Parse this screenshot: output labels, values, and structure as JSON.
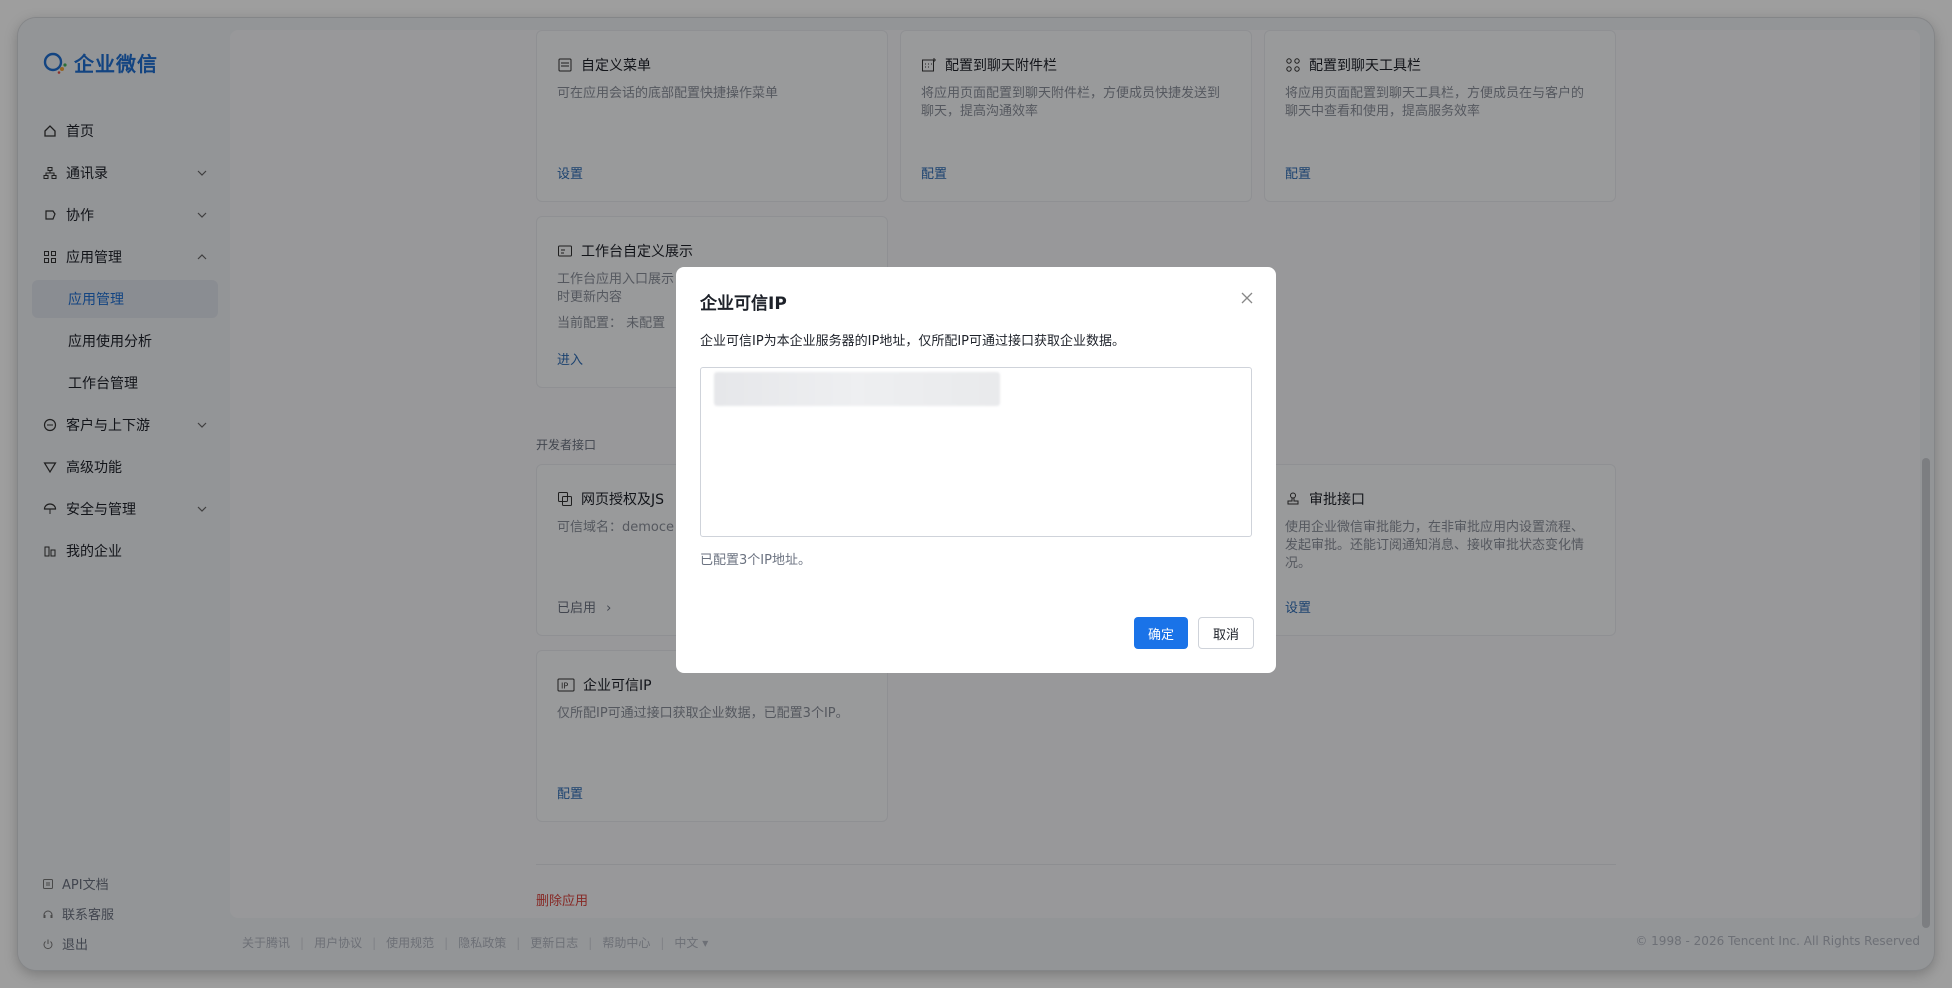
{
  "app": {
    "name": "企业微信",
    "brand_color": "#1f6fd1",
    "accent_color": "#1a73e8"
  },
  "sidebar": {
    "items": [
      {
        "label": "首页",
        "icon": "home-icon",
        "expandable": false
      },
      {
        "label": "通讯录",
        "icon": "org-chart-icon",
        "expandable": true
      },
      {
        "label": "协作",
        "icon": "collab-icon",
        "expandable": true
      },
      {
        "label": "应用管理",
        "icon": "apps-grid-icon",
        "expandable": true,
        "expanded": true
      },
      {
        "label": "客户与上下游",
        "icon": "chat-bubble-icon",
        "expandable": true
      },
      {
        "label": "高级功能",
        "icon": "diamond-icon",
        "expandable": false
      },
      {
        "label": "安全与管理",
        "icon": "umbrella-icon",
        "expandable": true
      },
      {
        "label": "我的企业",
        "icon": "building-icon",
        "expandable": false
      }
    ],
    "subitems": [
      {
        "label": "应用管理",
        "active": true
      },
      {
        "label": "应用使用分析",
        "active": false
      },
      {
        "label": "工作台管理",
        "active": false
      }
    ],
    "footer": [
      {
        "label": "API文档",
        "icon": "doc-icon"
      },
      {
        "label": "联系客服",
        "icon": "headset-icon"
      },
      {
        "label": "退出",
        "icon": "power-icon"
      }
    ]
  },
  "cards": {
    "custom_menu": {
      "title": "自定义菜单",
      "desc": "可在应用会话的底部配置快捷操作菜单",
      "link": "设置"
    },
    "chat_attachment": {
      "title": "配置到聊天附件栏",
      "desc": "将应用页面配置到聊天附件栏，方便成员快捷发送到聊天，提高沟通效率",
      "link": "配置"
    },
    "chat_toolbar": {
      "title": "配置到聊天工具栏",
      "desc": "将应用页面配置到聊天工具栏，方便成员在与客户的聊天中查看和使用，提高服务效率",
      "link": "配置"
    },
    "workbench": {
      "title": "工作台自定义展示",
      "desc": "工作台应用入口展示",
      "desc2": "时更新内容",
      "current": "当前配置：  未配置",
      "link": "进入"
    },
    "web_auth": {
      "title": "网页授权及JS",
      "desc": "可信域名：democe",
      "link": "已启用"
    },
    "approval": {
      "title": "审批接口",
      "desc": "使用企业微信审批能力，在非审批应用内设置流程、发起审批。还能订阅通知消息、接收审批状态变化情况。",
      "link": "设置"
    },
    "trusted_ip": {
      "title": "企业可信IP",
      "desc": "仅所配IP可通过接口获取企业数据，已配置3个IP。",
      "link": "配置"
    }
  },
  "section": {
    "dev_interface": "开发者接口"
  },
  "delete_app": "删除应用",
  "footer": {
    "links": [
      "关于腾讯",
      "用户协议",
      "使用规范",
      "隐私政策",
      "更新日志",
      "帮助中心",
      "中文"
    ],
    "copyright": "© 1998 - 2026 Tencent Inc. All Rights Reserved"
  },
  "modal": {
    "title": "企业可信IP",
    "desc": "企业可信IP为本企业服务器的IP地址，仅所配IP可通过接口获取企业数据。",
    "textarea_value": "",
    "hint": "已配置3个IP地址。",
    "confirm": "确定",
    "cancel": "取消"
  }
}
